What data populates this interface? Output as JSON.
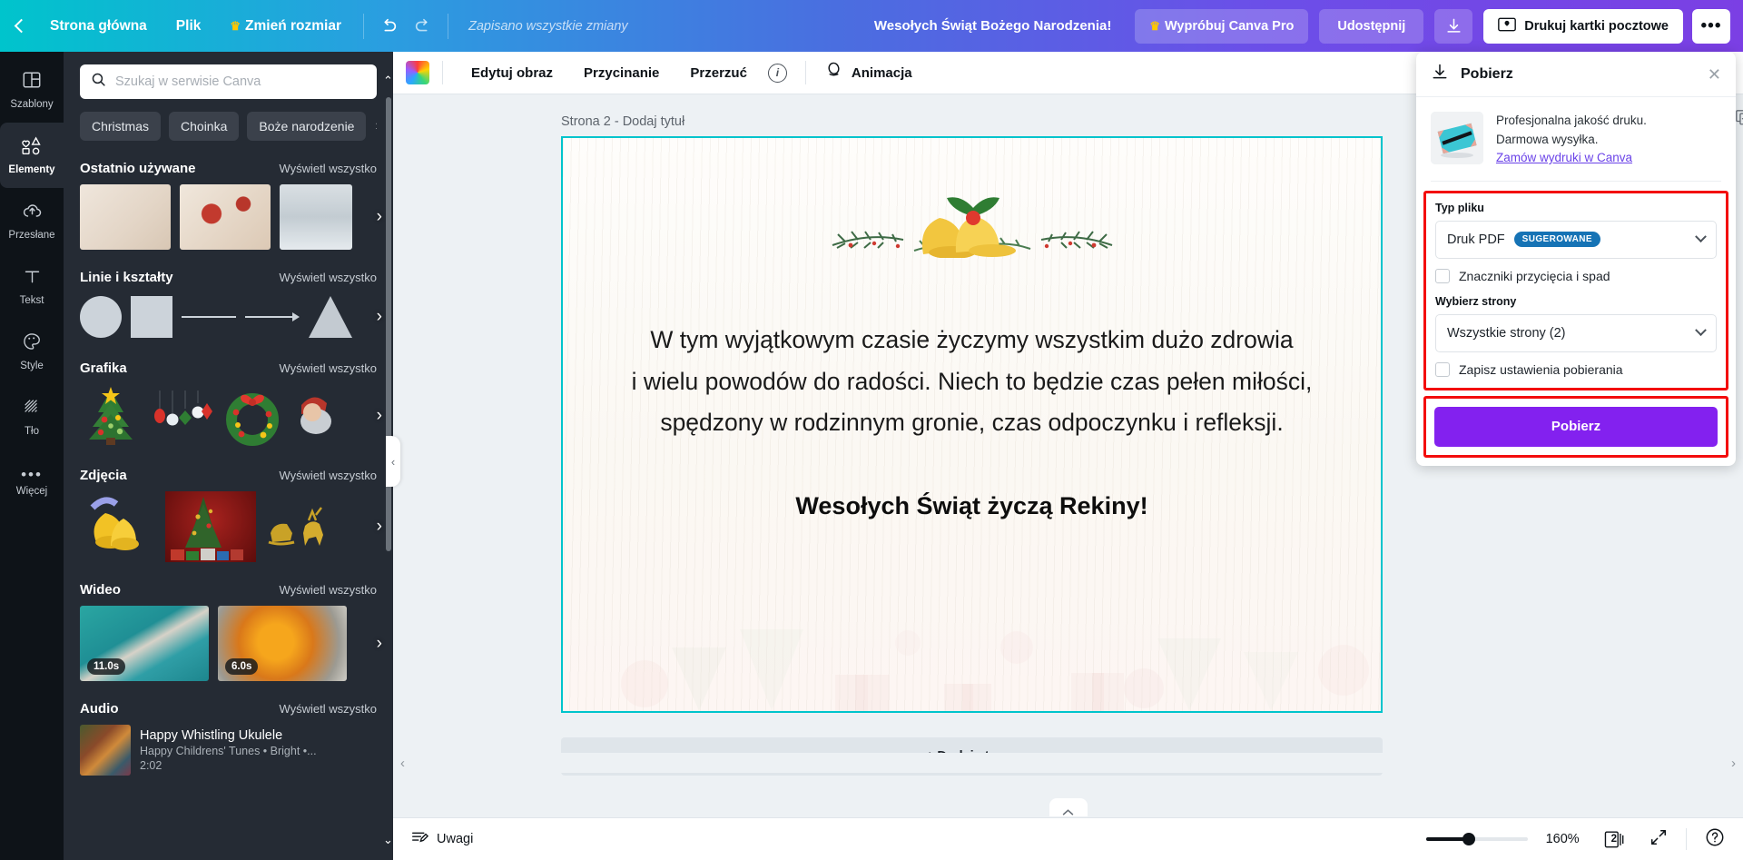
{
  "topbar": {
    "back_label": "Strona główna",
    "file_label": "Plik",
    "resize_label": "Zmień rozmiar",
    "saved_status": "Zapisano wszystkie zmiany",
    "doc_title": "Wesołych Świąt Bożego Narodzenia!",
    "try_pro_label": "Wypróbuj Canva Pro",
    "share_label": "Udostępnij",
    "print_label": "Drukuj kartki pocztowe",
    "gradient_start": "#00c4cc",
    "gradient_end": "#7b3fe4"
  },
  "rail": {
    "items": [
      {
        "label": "Szablony",
        "icon": "templates-icon",
        "active": false
      },
      {
        "label": "Elementy",
        "icon": "elements-icon",
        "active": true
      },
      {
        "label": "Przesłane",
        "icon": "upload-icon",
        "active": false
      },
      {
        "label": "Tekst",
        "icon": "text-icon",
        "active": false
      },
      {
        "label": "Style",
        "icon": "styles-icon",
        "active": false
      },
      {
        "label": "Tło",
        "icon": "background-icon",
        "active": false
      },
      {
        "label": "Więcej",
        "icon": "more-icon",
        "active": false
      }
    ]
  },
  "panel": {
    "search_placeholder": "Szukaj w serwisie Canva",
    "search_value": "",
    "chips": [
      "Christmas",
      "Choinka",
      "Boże narodzenie"
    ],
    "view_all_label": "Wyświetl wszystko",
    "sections": [
      {
        "title": "Ostatnio używane"
      },
      {
        "title": "Linie i kształty"
      },
      {
        "title": "Grafika"
      },
      {
        "title": "Zdjęcia"
      },
      {
        "title": "Wideo"
      },
      {
        "title": "Audio"
      }
    ],
    "video_durations": [
      "11.0s",
      "6.0s"
    ],
    "audio": {
      "track_title": "Happy Whistling Ukulele",
      "track_meta": "Happy Childrens' Tunes • Bright •...",
      "track_duration": "2:02"
    }
  },
  "editor": {
    "toolbar": {
      "edit_image": "Edytuj obraz",
      "crop": "Przycinanie",
      "flip": "Przerzuć",
      "animate": "Animacja"
    },
    "page_label": "Strona 2 - Dodaj tytuł",
    "add_page_label": "+ Dodaj stronę"
  },
  "card": {
    "body_lines": [
      "W tym wyjątkowym czasie życzymy wszystkim dużo zdrowia",
      "i wielu powodów do radości. Niech to będzie czas pełen miłości,",
      "spędzony w rodzinnym gronie, czas odpoczynku i refleksji."
    ],
    "signature": "Wesołych Świąt życzą Rekiny!",
    "border_color": "#00c4cc"
  },
  "bottombar": {
    "comments_label": "Uwagi",
    "zoom_level": "160%",
    "page_count": "2"
  },
  "download_panel": {
    "title": "Pobierz",
    "promo_line1": "Profesjonalna jakość druku.",
    "promo_line2": "Darmowa wysyłka.",
    "promo_link": "Zamów wydruki w Canva",
    "file_type_label": "Typ pliku",
    "file_type_value": "Druk PDF",
    "file_type_badge": "SUGEROWANE",
    "crop_marks_label": "Znaczniki przycięcia i spad",
    "crop_marks_checked": false,
    "pages_label": "Wybierz strony",
    "pages_value": "Wszystkie strony (2)",
    "save_settings_label": "Zapisz ustawienia pobierania",
    "save_settings_checked": false,
    "download_button": "Pobierz",
    "accent_color": "#8321ef",
    "highlight_color": "#f30c0c",
    "badge_color": "#1673b5"
  }
}
